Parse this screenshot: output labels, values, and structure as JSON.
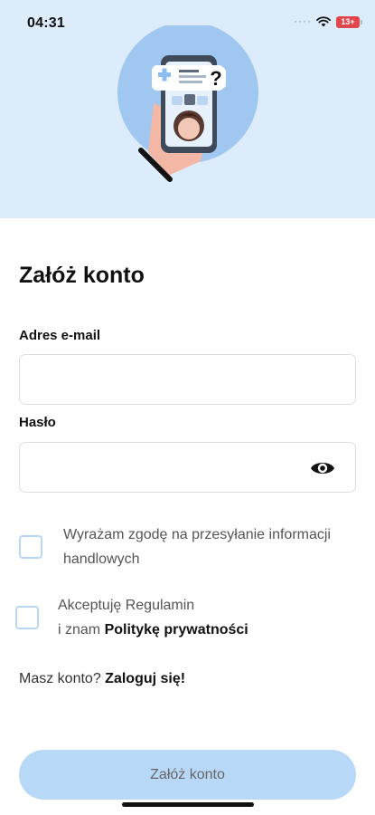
{
  "status_bar": {
    "time": "04:31",
    "signal_dots": "····",
    "battery": "13+"
  },
  "header": {
    "title": "Załóż konto"
  },
  "form": {
    "email": {
      "label": "Adres e-mail",
      "value": "",
      "placeholder": ""
    },
    "password": {
      "label": "Hasło",
      "value": "",
      "placeholder": ""
    },
    "marketing_consent": {
      "text": "Wyrażam zgodę na przesyłanie informacji handlowych",
      "checked": false
    },
    "terms": {
      "text_prefix": "Akceptuję Regulamin",
      "text_line2_prefix": "i znam ",
      "privacy_link": "Politykę prywatności",
      "checked": false
    }
  },
  "login": {
    "prompt": "Masz konto?",
    "link": "Zaloguj się!"
  },
  "submit": {
    "label": "Załóż konto"
  },
  "colors": {
    "hero_bg": "#dcecfb",
    "accent": "#b8d8f8",
    "checkbox_border": "#b8d7f6",
    "battery": "#e0464b"
  },
  "icons": {
    "wifi": "wifi-icon",
    "eye": "eye-icon",
    "battery": "battery-icon"
  }
}
